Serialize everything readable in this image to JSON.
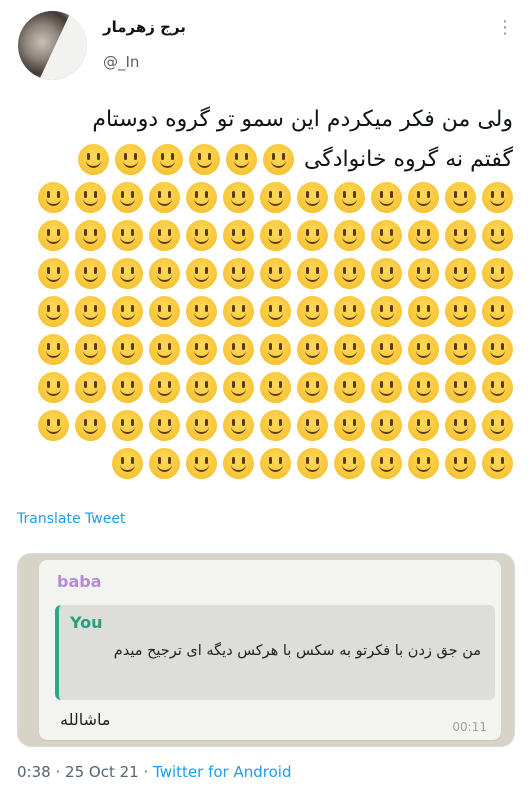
{
  "tweet": {
    "display_name": "برج زهرمار",
    "handle": "@_In",
    "text_line_1": "ولی من فکر میکردم این سمو تو گروه دوستام",
    "text_line_2": "گفتم نه گروه خانوادگی",
    "emoji_rows": [
      6,
      13,
      13,
      13,
      13,
      13,
      13,
      13,
      11
    ],
    "translate_label": "Translate Tweet",
    "time": "0:38",
    "dot": "·",
    "date": "25 Oct 21",
    "source": "Twitter for Android"
  },
  "chat_screenshot": {
    "sender": "baba",
    "reply_author": "You",
    "reply_text": "من جق زدن با فکرتو به سکس با هرکس دیگه ای ترجیح میدم",
    "message_text": "ماشالله",
    "message_time": "00:11"
  },
  "colors": {
    "link": "#1d9bf0",
    "sender": "#b88bd7",
    "reply_accent": "#2ea68c"
  },
  "icons": {
    "more": "more-dots-icon",
    "emoji": "slightly-smiling-face"
  }
}
